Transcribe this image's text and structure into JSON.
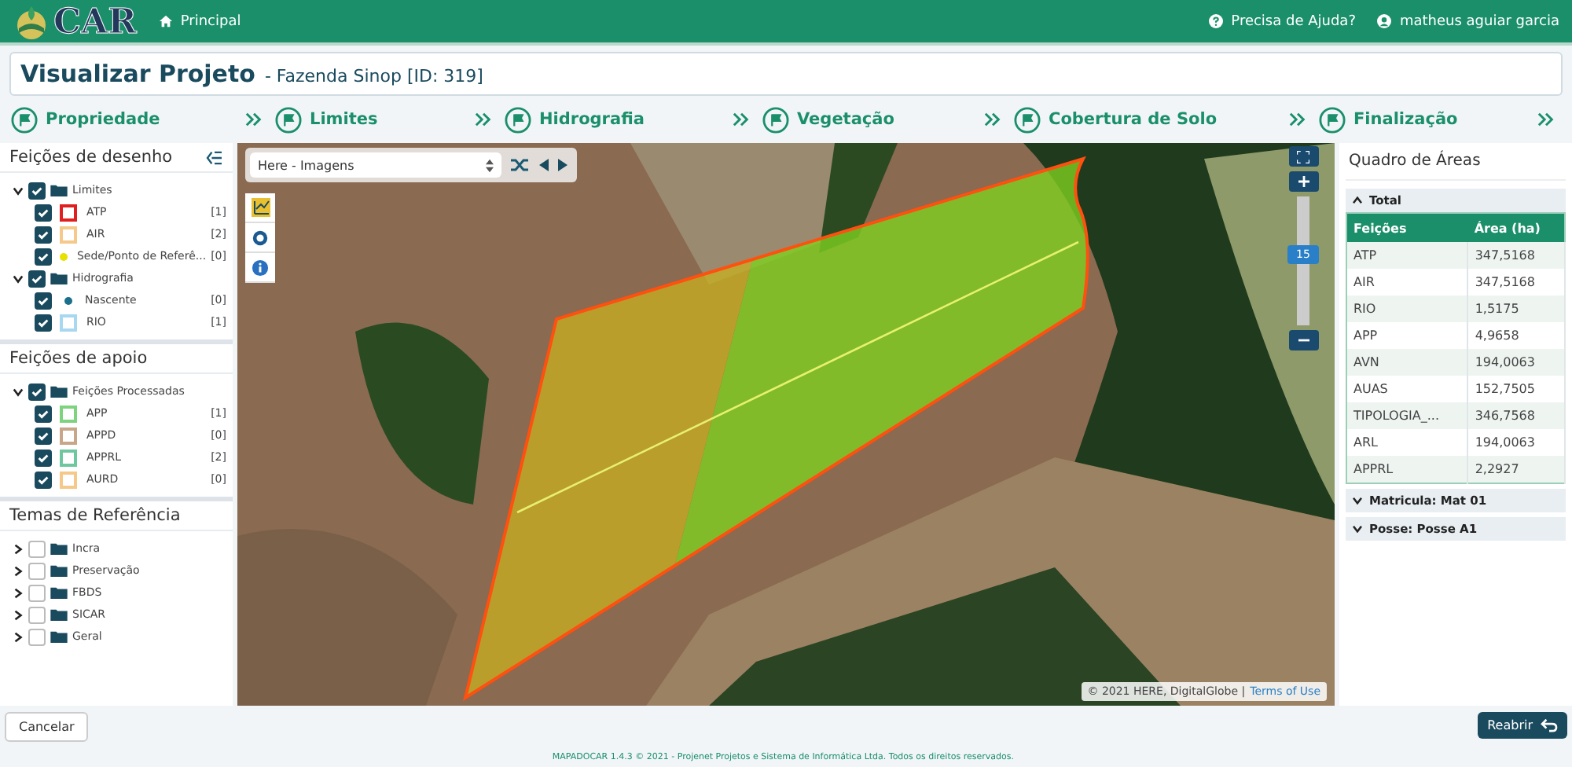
{
  "header": {
    "logo": "CAR",
    "nav": "Principal",
    "help": "Precisa de Ajuda?",
    "user": "matheus aguiar garcia"
  },
  "page_title": {
    "title": "Visualizar Projeto",
    "subtitle": "- Fazenda Sinop [ID: 319]"
  },
  "steps": [
    "Propriedade",
    "Limites",
    "Hidrografia",
    "Vegetação",
    "Cobertura de Solo",
    "Finalização"
  ],
  "left_panels": [
    {
      "title": "Feições de desenho",
      "collapse_icon": true,
      "items": [
        {
          "kind": "folder",
          "label": "Limites",
          "checked": true,
          "expanded": true,
          "children": [
            {
              "kind": "square",
              "label": "ATP",
              "checked": true,
              "color": "#e02020",
              "count": "[1]"
            },
            {
              "kind": "square",
              "label": "AIR",
              "checked": true,
              "color": "#f5c98a",
              "count": "[2]"
            },
            {
              "kind": "dot",
              "label": "Sede/Ponto de Referê...",
              "checked": true,
              "color": "#e8e000",
              "count": "[0]"
            }
          ]
        },
        {
          "kind": "folder",
          "label": "Hidrografia",
          "checked": true,
          "expanded": true,
          "children": [
            {
              "kind": "dot",
              "label": "Nascente",
              "checked": true,
              "color": "#1a6f8a",
              "count": "[0]"
            },
            {
              "kind": "square",
              "label": "RIO",
              "checked": true,
              "color": "#a8d8f0",
              "count": "[1]"
            }
          ]
        }
      ]
    },
    {
      "title": "Feições de apoio",
      "items": [
        {
          "kind": "folder",
          "label": "Feições Processadas",
          "checked": true,
          "expanded": true,
          "children": [
            {
              "kind": "square",
              "label": "APP",
              "checked": true,
              "color": "#7ed37e",
              "count": "[1]"
            },
            {
              "kind": "square",
              "label": "APPD",
              "checked": true,
              "color": "#c8a68a",
              "count": "[0]"
            },
            {
              "kind": "square",
              "label": "APPRL",
              "checked": true,
              "color": "#6fc7a0",
              "count": "[2]"
            },
            {
              "kind": "square",
              "label": "AURD",
              "checked": true,
              "color": "#f5c98a",
              "count": "[0]"
            }
          ]
        }
      ]
    },
    {
      "title": "Temas de Referência",
      "items": [
        {
          "kind": "folder",
          "label": "Incra",
          "checked": false,
          "expanded": false
        },
        {
          "kind": "folder",
          "label": "Preservação",
          "checked": false,
          "expanded": false
        },
        {
          "kind": "folder",
          "label": "FBDS",
          "checked": false,
          "expanded": false
        },
        {
          "kind": "folder",
          "label": "SICAR",
          "checked": false,
          "expanded": false
        },
        {
          "kind": "folder",
          "label": "Geral",
          "checked": false,
          "expanded": false
        }
      ]
    }
  ],
  "map": {
    "layer_select": "Here - Imagens",
    "zoom_label": "15",
    "zoom": {
      "level": 0.55
    },
    "attribution": "© 2021 HERE, DigitalGlobe |",
    "terms_link": "Terms of Use"
  },
  "areas": {
    "title": "Quadro de Áreas",
    "sections": [
      {
        "label": "Total",
        "expanded": true
      },
      {
        "label": "Matricula: Mat 01",
        "expanded": false
      },
      {
        "label": "Posse: Posse A1",
        "expanded": false
      }
    ],
    "columns": [
      "Feições",
      "Área (ha)"
    ],
    "rows": [
      [
        "ATP",
        "347,5168"
      ],
      [
        "AIR",
        "347,5168"
      ],
      [
        "RIO",
        "1,5175"
      ],
      [
        "APP",
        "4,9658"
      ],
      [
        "AVN",
        "194,0063"
      ],
      [
        "AUAS",
        "152,7505"
      ],
      [
        "TIPOLOGIA_...",
        "346,7568"
      ],
      [
        "ARL",
        "194,0063"
      ],
      [
        "APPRL",
        "2,2927"
      ]
    ]
  },
  "footer": {
    "cancel": "Cancelar",
    "reopen": "Reabrir",
    "copyright": "MAPADOCAR 1.4.3 © 2021 - Projenet Projetos e Sistema de Informática Ltda. Todos os direitos reservados."
  }
}
